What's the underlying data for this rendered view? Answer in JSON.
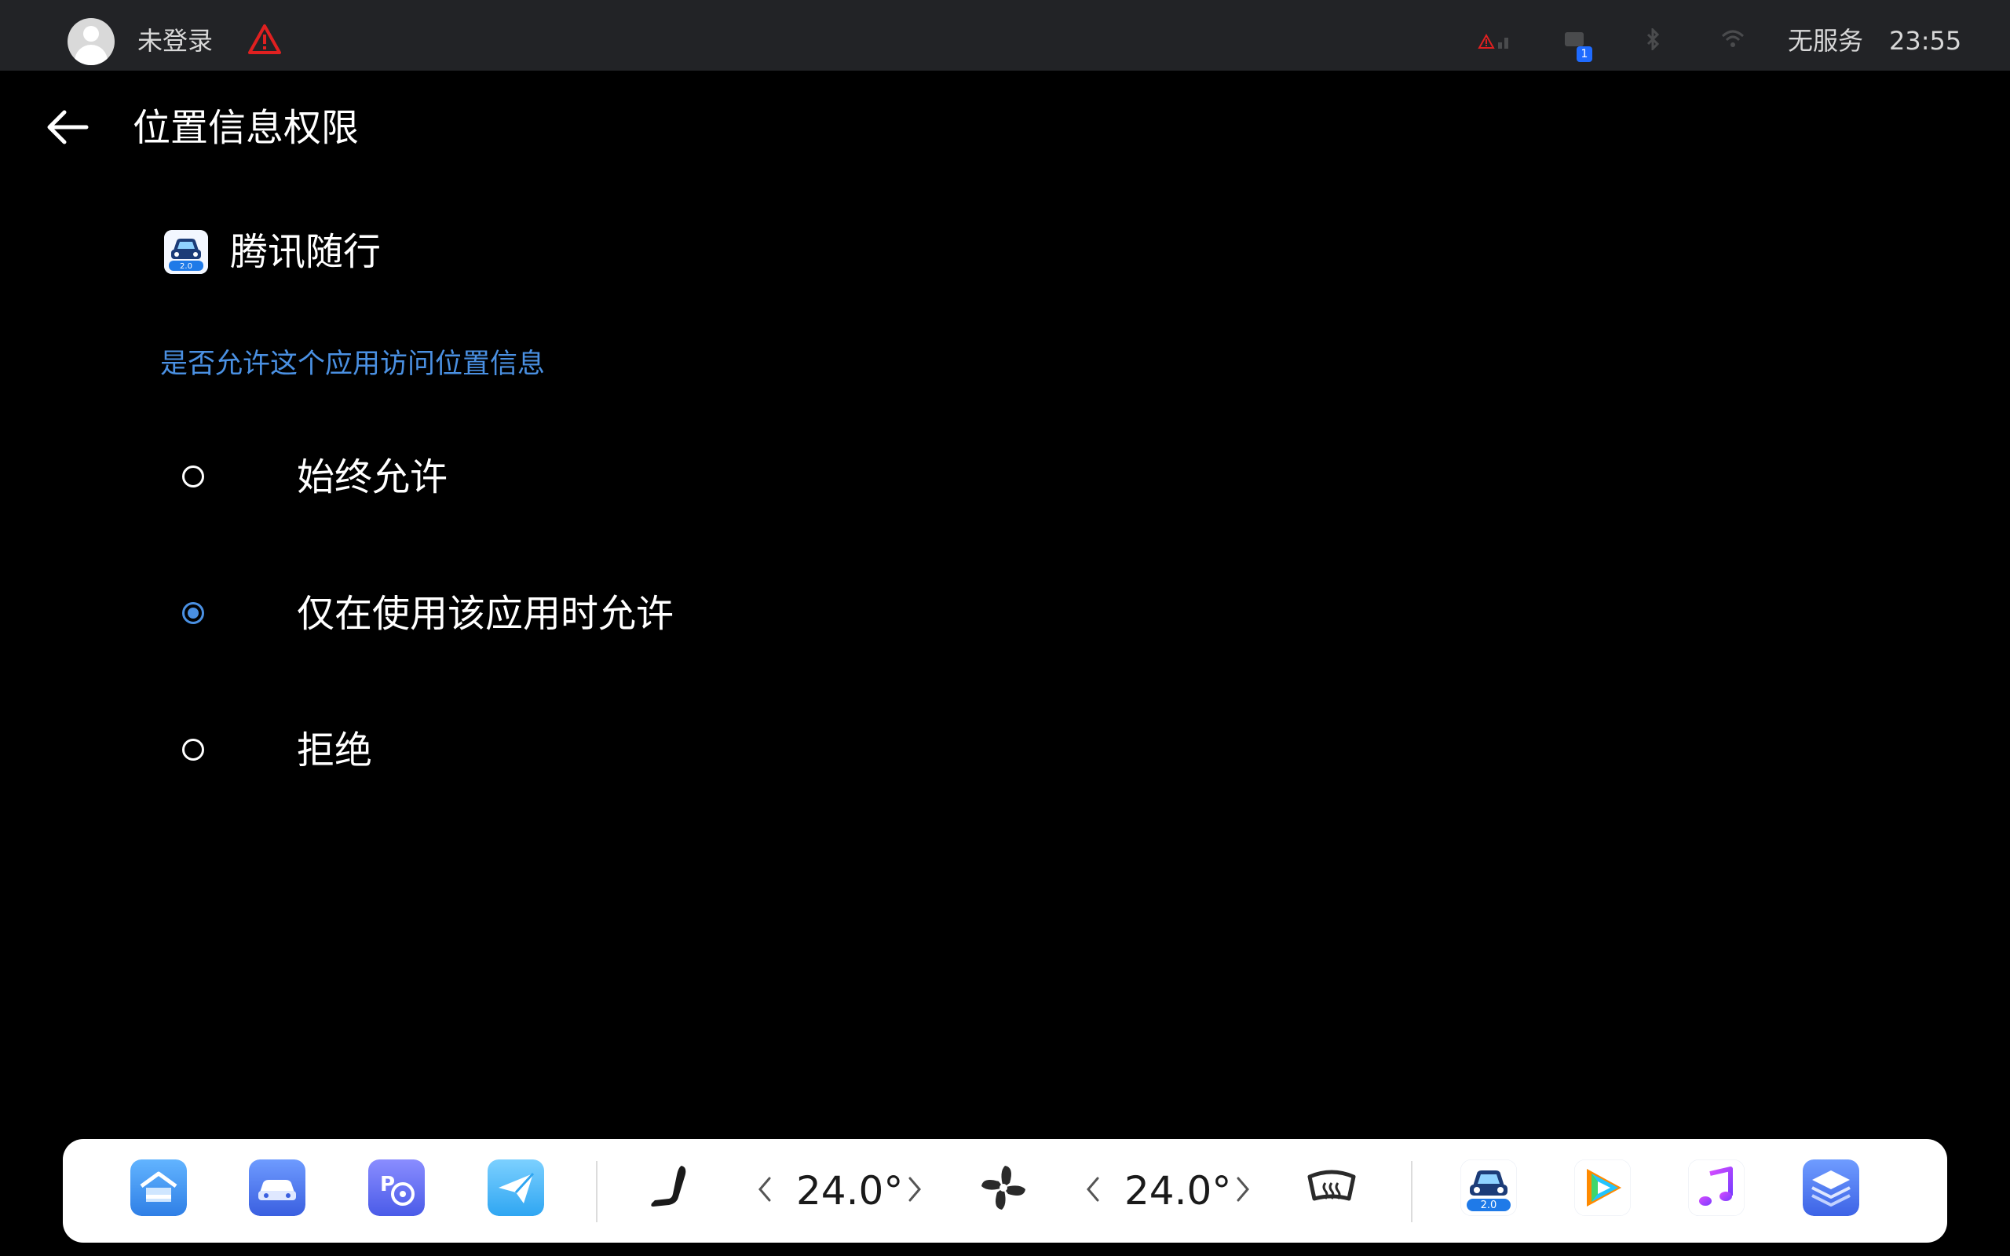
{
  "status_bar": {
    "login_status": "未登录",
    "notification_count": "1",
    "network_status": "无服务",
    "time": "23:55"
  },
  "header": {
    "title": "位置信息权限"
  },
  "app": {
    "name": "腾讯随行",
    "icon_version": "2.0"
  },
  "permission": {
    "question": "是否允许这个应用访问位置信息",
    "options": [
      {
        "label": "始终允许",
        "selected": false
      },
      {
        "label": "仅在使用该应用时允许",
        "selected": true
      },
      {
        "label": "拒绝",
        "selected": false
      }
    ]
  },
  "dock": {
    "left_temp": "24.0°",
    "right_temp": "24.0°",
    "app_version_badge": "2.0"
  },
  "colors": {
    "accent": "#4a90e2",
    "status_bar_bg": "#222326",
    "warning": "#e02020"
  }
}
